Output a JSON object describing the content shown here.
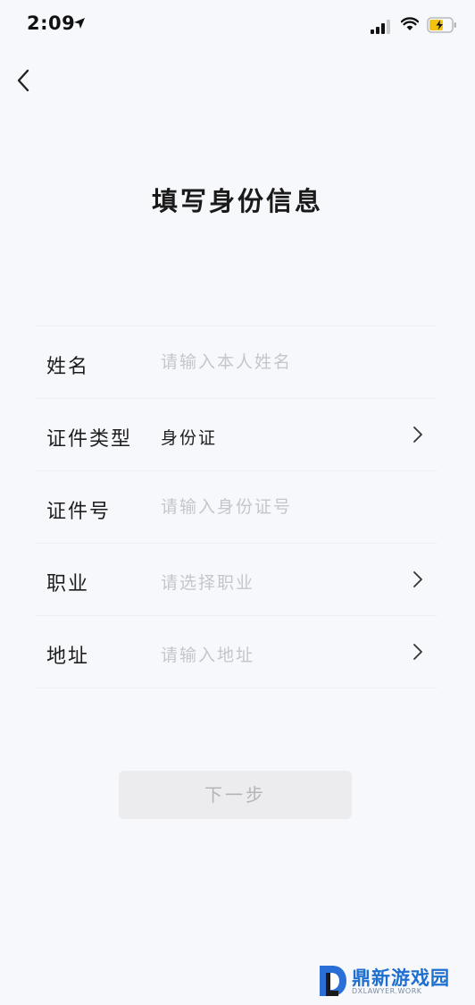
{
  "status_bar": {
    "time": "2:09",
    "icons": [
      "location-arrow-icon",
      "cellular-signal-icon",
      "wifi-icon",
      "battery-icon"
    ]
  },
  "nav": {
    "back_icon": "chevron-left-icon"
  },
  "page": {
    "title": "填写身份信息"
  },
  "form": {
    "rows": [
      {
        "label": "姓名",
        "placeholder": "请输入本人姓名",
        "value": ""
      },
      {
        "label": "证件类型",
        "value": "身份证",
        "has_chevron": true
      },
      {
        "label": "证件号",
        "placeholder": "请输入身份证号",
        "value": ""
      },
      {
        "label": "职业",
        "placeholder": "请选择职业",
        "has_chevron": true
      },
      {
        "label": "地址",
        "placeholder": "请输入地址",
        "has_chevron": true
      }
    ]
  },
  "actions": {
    "next_label": "下一步"
  },
  "watermark": {
    "title": "鼎新游戏园",
    "subtitle": "DXLAWYER.WORK"
  },
  "colors": {
    "background": "#f7f8fb",
    "placeholder": "#c4c6cc",
    "text": "#1e1e1e",
    "button_disabled_bg": "#ececef",
    "button_disabled_text": "#b3b5ba",
    "watermark_blue": "#1f6fd1"
  }
}
